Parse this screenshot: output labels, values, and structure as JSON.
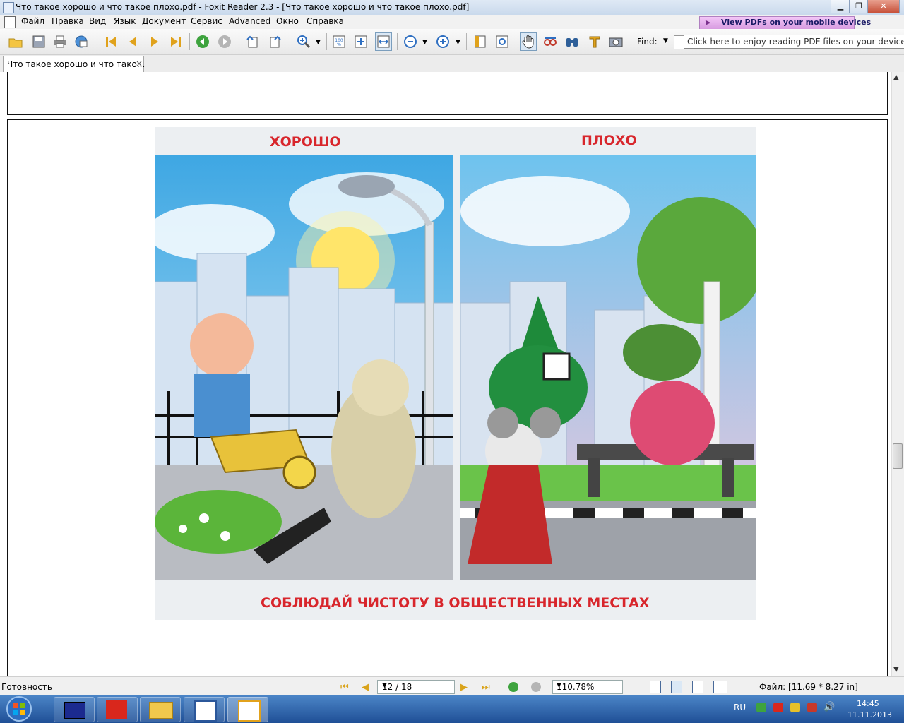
{
  "window": {
    "title": "Что такое хорошо и что такое плохо.pdf - Foxit Reader 2.3 - [Что такое хорошо и что такое плохо.pdf]",
    "min_icon": "minimize-icon",
    "max_icon": "restore-icon",
    "close_icon": "close-icon",
    "min": "▁",
    "max": "❐",
    "close": "✕"
  },
  "menu": {
    "items": [
      "Файл",
      "Правка",
      "Вид",
      "Язык",
      "Документ",
      "Сервис",
      "Advanced",
      "Окно",
      "Справка"
    ]
  },
  "promo": {
    "text": "View PDFs on your mobile devices"
  },
  "toolbar": {
    "find_label": "Find:",
    "tooltip": "Click here to enjoy reading PDF files on your device now!"
  },
  "tab": {
    "label": "Что такое хорошо и что тако...",
    "close": "×"
  },
  "poster": {
    "good_heading": "ХОРОШО",
    "bad_heading": "ПЛОХО",
    "caption": "СОБЛЮДАЙ ЧИСТОТУ В ОБЩЕСТВЕННЫХ МЕСТАХ"
  },
  "status": {
    "text": "Готовность",
    "page": "12 / 18",
    "zoom": "110.78%",
    "file_info": "Файл: [11.69 * 8.27 in]"
  },
  "taskbar": {
    "lang": "RU",
    "time": "14:45",
    "date": "11.11.2013"
  },
  "colors": {
    "heading_red": "#d8262c",
    "sky_blue": "#4fb2e6",
    "taskbar_blue": "#2a5ea8"
  }
}
